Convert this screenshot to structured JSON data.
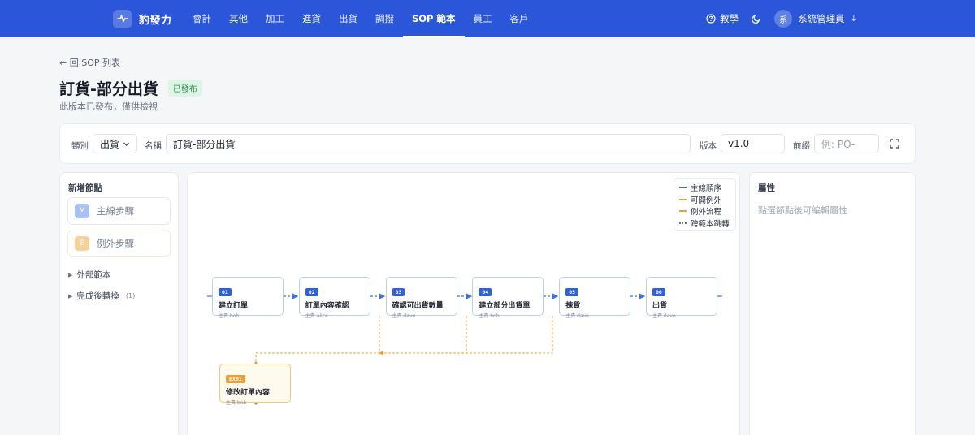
{
  "app": {
    "name": "豹發力"
  },
  "nav": {
    "items": [
      "會計",
      "其他",
      "加工",
      "進貨",
      "出貨",
      "調撥",
      "SOP 範本",
      "員工",
      "客戶"
    ],
    "active_index": 6,
    "help_label": "教學",
    "user_avatar": "系",
    "user_name": "系統管理員",
    "user_arrow": "↓"
  },
  "header": {
    "back_label": "← 回 SOP 列表",
    "title": "訂貨-部分出貨",
    "status_badge": "已發布",
    "subtitle": "此版本已發布，僅供檢視"
  },
  "form": {
    "category_label": "類別",
    "category_value": "出貨",
    "name_label": "名稱",
    "name_value": "訂貨-部分出貨",
    "version_label": "版本",
    "version_value": "v1.0",
    "prefix_label": "前綴",
    "prefix_placeholder": "例: PO-"
  },
  "palette": {
    "title": "新增節點",
    "main_step": {
      "chip": "M",
      "label": "主線步驟"
    },
    "exception_step": {
      "chip": "E",
      "label": "例外步驟"
    },
    "external_template": "外部範本",
    "after_complete": "完成後轉換",
    "after_complete_count": "(1)"
  },
  "legend": [
    {
      "label": "主線順序",
      "color": "#3f6fe0",
      "style": "solid"
    },
    {
      "label": "可開例外",
      "color": "#e8a13a",
      "style": "dashed"
    },
    {
      "label": "例外流程",
      "color": "#e8a13a",
      "style": "solid"
    },
    {
      "label": "跨範本跳轉",
      "color": "#6b7180",
      "style": "dotted"
    }
  ],
  "nodes": [
    {
      "code": "01",
      "label": "建立訂單",
      "owner": "主責 bob"
    },
    {
      "code": "02",
      "label": "訂單內容確認",
      "owner": "主責 alice"
    },
    {
      "code": "03",
      "label": "確認可出貨數量",
      "owner": "主責 dave"
    },
    {
      "code": "04",
      "label": "建立部分出貨單",
      "owner": "主責 bob"
    },
    {
      "code": "05",
      "label": "揀貨",
      "owner": "主責 dave"
    },
    {
      "code": "06",
      "label": "出貨",
      "owner": "主責 dave"
    }
  ],
  "exception_node": {
    "code": "EX01",
    "label": "修改訂單內容",
    "owner": "主責 bob"
  },
  "properties": {
    "title": "屬性",
    "hint": "點選節點後可編輯屬性"
  },
  "colors": {
    "primary": "#2b56d9",
    "main_edge": "#3f6fe0",
    "exception_edge": "#e8a13a",
    "success_badge": "#dcf5e4"
  }
}
